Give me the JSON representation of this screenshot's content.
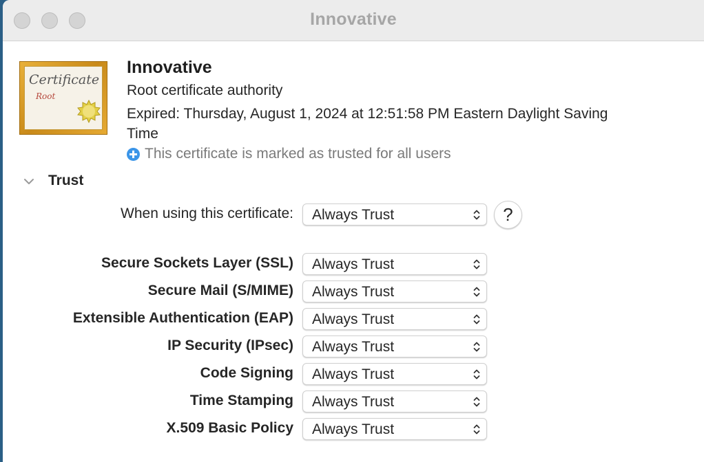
{
  "window": {
    "title": "Innovative"
  },
  "certificate": {
    "icon_text": "Certificate",
    "icon_subtext": "Root",
    "name": "Innovative",
    "kind": "Root certificate authority",
    "expiry": "Expired: Thursday, August 1, 2024 at 12:51:58 PM Eastern Daylight Saving Time",
    "trust_status": "This certificate is marked as trusted for all users",
    "trust_status_icon": "plus-circle-icon",
    "trust_status_icon_color": "#3b95e8"
  },
  "trust": {
    "section_title": "Trust",
    "disclosure_state": "expanded",
    "when_using_label": "When using this certificate:",
    "when_using_value": "Always Trust",
    "help_label": "?",
    "policies": [
      {
        "label": "Secure Sockets Layer (SSL)",
        "value": "Always Trust"
      },
      {
        "label": "Secure Mail (S/MIME)",
        "value": "Always Trust"
      },
      {
        "label": "Extensible Authentication (EAP)",
        "value": "Always Trust"
      },
      {
        "label": "IP Security (IPsec)",
        "value": "Always Trust"
      },
      {
        "label": "Code Signing",
        "value": "Always Trust"
      },
      {
        "label": "Time Stamping",
        "value": "Always Trust"
      },
      {
        "label": "X.509 Basic Policy",
        "value": "Always Trust"
      }
    ]
  }
}
